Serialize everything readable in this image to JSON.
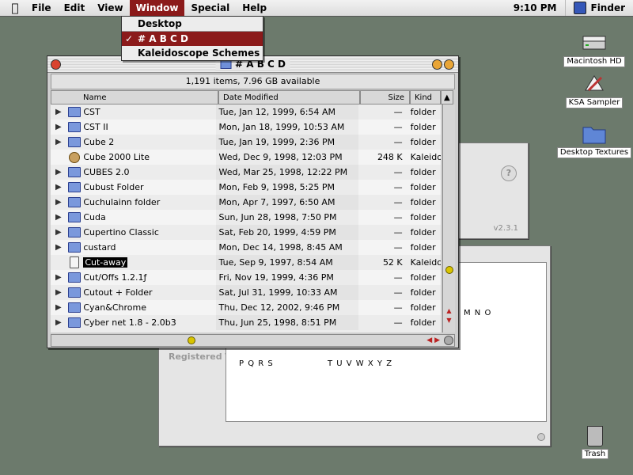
{
  "menubar": {
    "apple_icon": "apple-icon",
    "menus": [
      "File",
      "Edit",
      "View",
      "Window",
      "Special",
      "Help"
    ],
    "active_menu": "Window",
    "clock": "9:10 PM",
    "app": "Finder"
  },
  "window_menu": {
    "items": [
      {
        "label": "Desktop",
        "checked": false,
        "selected": false
      },
      {
        "label": "# A B C D",
        "checked": true,
        "selected": true
      },
      {
        "label": "Kaleidoscope Schemes",
        "checked": false,
        "selected": false
      }
    ]
  },
  "desktop": {
    "icons": [
      {
        "label": "Macintosh HD",
        "icon": "hard-drive-icon"
      },
      {
        "label": "KSA Sampler",
        "icon": "application-icon"
      },
      {
        "label": "Desktop Textures",
        "icon": "folder-icon"
      }
    ],
    "trash": "Trash"
  },
  "background_windows": {
    "version": "v2.3.1",
    "registered": "Registered T",
    "letters_right": "M N O",
    "letters_left": "P Q R S",
    "letters_mid": "T U V W X Y Z"
  },
  "finder_window": {
    "title": "# A B C D",
    "info": "1,191 items, 7.96 GB available",
    "columns": {
      "name": "Name",
      "date": "Date Modified",
      "size": "Size",
      "kind": "Kind"
    },
    "rows": [
      {
        "name": "CST",
        "date": "Tue, Jan 12, 1999, 6:54 AM",
        "size": "—",
        "kind": "folder",
        "type": "folder"
      },
      {
        "name": "CST II",
        "date": "Mon, Jan 18, 1999, 10:53 AM",
        "size": "—",
        "kind": "folder",
        "type": "folder"
      },
      {
        "name": "Cube 2",
        "date": "Tue, Jan 19, 1999, 2:36 PM",
        "size": "—",
        "kind": "folder",
        "type": "folder"
      },
      {
        "name": "Cube 2000 Lite",
        "date": "Wed, Dec 9, 1998, 12:03 PM",
        "size": "248 K",
        "kind": "Kaleido",
        "type": "app"
      },
      {
        "name": "CUBES 2.0",
        "date": "Wed, Mar 25, 1998, 12:22 PM",
        "size": "—",
        "kind": "folder",
        "type": "folder"
      },
      {
        "name": "Cubust Folder",
        "date": "Mon, Feb 9, 1998, 5:25 PM",
        "size": "—",
        "kind": "folder",
        "type": "folder"
      },
      {
        "name": "Cuchulainn folder",
        "date": "Mon, Apr 7, 1997, 6:50 AM",
        "size": "—",
        "kind": "folder",
        "type": "folder"
      },
      {
        "name": "Cuda",
        "date": "Sun, Jun 28, 1998, 7:50 PM",
        "size": "—",
        "kind": "folder",
        "type": "folder"
      },
      {
        "name": "Cupertino Classic",
        "date": "Sat, Feb 20, 1999, 4:59 PM",
        "size": "—",
        "kind": "folder",
        "type": "folder"
      },
      {
        "name": "custard",
        "date": "Mon, Dec 14, 1998, 8:45 AM",
        "size": "—",
        "kind": "folder",
        "type": "folder"
      },
      {
        "name": "Cut-away",
        "date": "Tue, Sep 9, 1997, 8:54 AM",
        "size": "52 K",
        "kind": "Kaleido",
        "type": "doc"
      },
      {
        "name": "Cut/Offs 1.2.1ƒ",
        "date": "Fri, Nov 19, 1999, 4:36 PM",
        "size": "—",
        "kind": "folder",
        "type": "folder"
      },
      {
        "name": "Cutout + Folder",
        "date": "Sat, Jul 31, 1999, 10:33 AM",
        "size": "—",
        "kind": "folder",
        "type": "folder"
      },
      {
        "name": "Cyan&Chrome",
        "date": "Thu, Dec 12, 2002, 9:46 PM",
        "size": "—",
        "kind": "folder",
        "type": "folder"
      },
      {
        "name": "Cyber net 1.8 - 2.0b3",
        "date": "Thu, Jun 25, 1998, 8:51 PM",
        "size": "—",
        "kind": "folder",
        "type": "folder"
      }
    ],
    "selected_row": "Cut-away"
  }
}
